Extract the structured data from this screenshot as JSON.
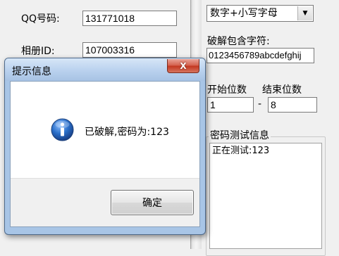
{
  "main_window": {
    "qq_label": "QQ号码:",
    "qq_value": "131771018",
    "album_label": "相册ID:",
    "album_value": "107003316",
    "charset_select": "数字+小写字母",
    "crack_chars_label": "破解包含字符:",
    "crack_chars_value": "0123456789abcdefghij",
    "start_digits_label": "开始位数",
    "end_digits_label": "结束位数",
    "start_digits_value": "1",
    "range_separator": "-",
    "end_digits_value": "8",
    "log_group_title": "密码测试信息",
    "log_text": "正在测试:123"
  },
  "dialog": {
    "title": "提示信息",
    "close_symbol": "X",
    "message": "已破解,密码为:123",
    "ok_label": "确定"
  },
  "colors": {
    "dialog_frame": "#a8c5e6",
    "close_button": "#c8432c",
    "window_background": "#f0f0f0",
    "info_icon": "#2a6fc9"
  },
  "icons": [
    "info-icon",
    "close-icon",
    "dropdown-arrow-icon"
  ]
}
